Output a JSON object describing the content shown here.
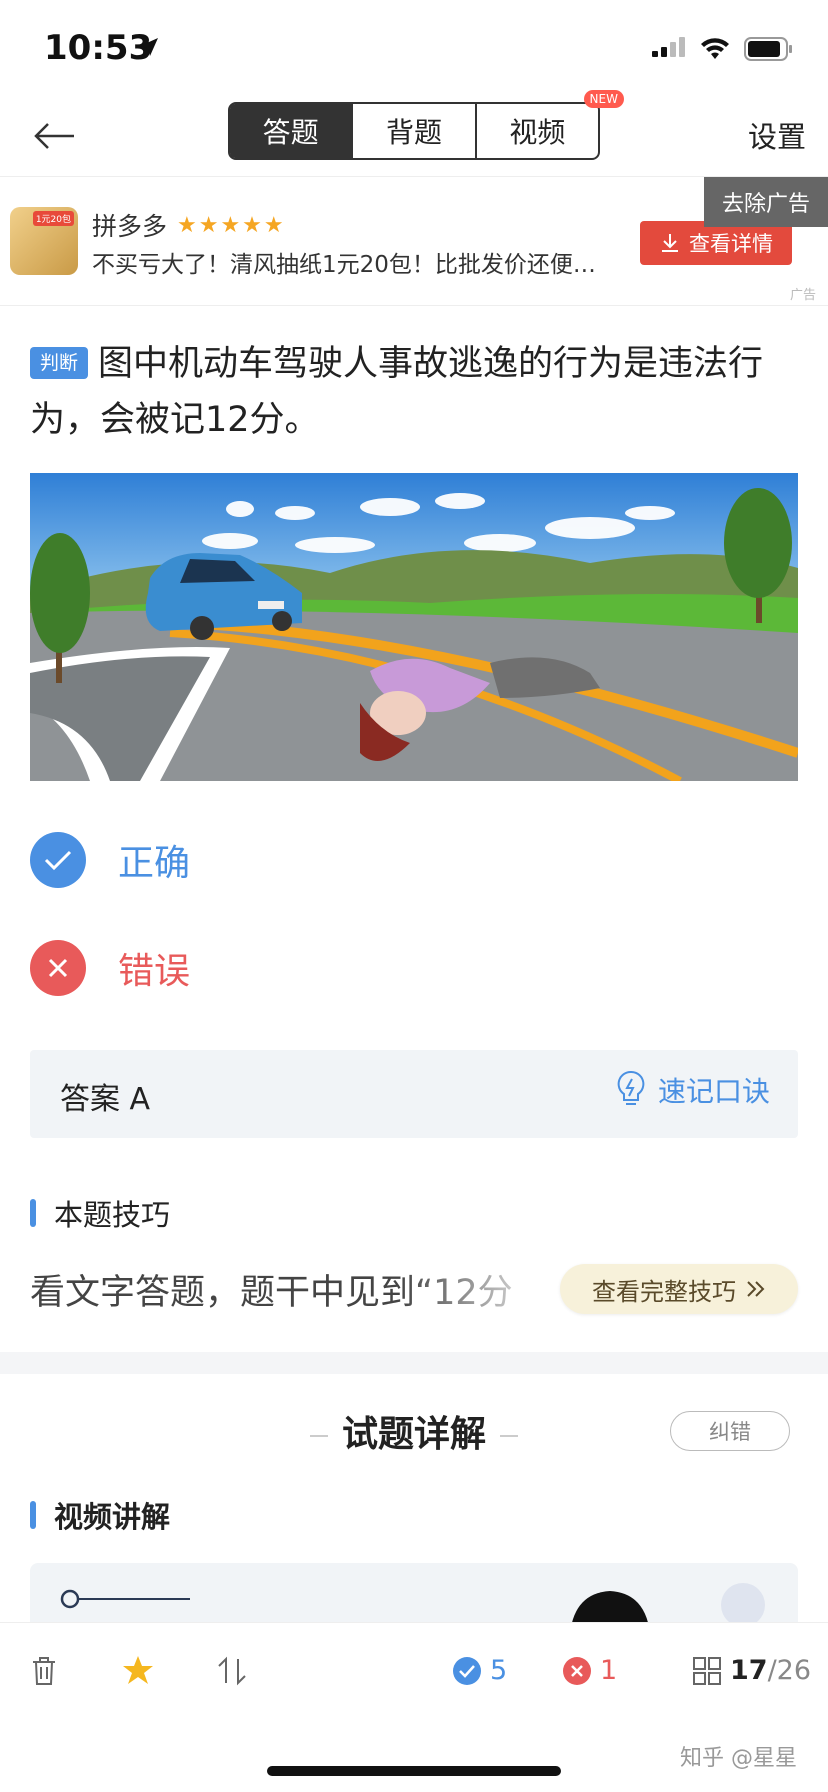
{
  "status_bar": {
    "time": "10:53"
  },
  "nav": {
    "tabs": [
      {
        "label": "答题",
        "active": true
      },
      {
        "label": "背题",
        "active": false
      },
      {
        "label": "视频",
        "active": false,
        "badge": "NEW"
      }
    ],
    "settings_label": "设置"
  },
  "ad": {
    "name": "拼多多",
    "rating_stars": "★★★★★",
    "description": "不买亏大了！清风抽纸1元20包！比批发价还便…",
    "button_label": "查看详情",
    "remove_label": "去除广告",
    "ad_label": "广告",
    "thumb_tag": "1元20包"
  },
  "question": {
    "type_tag": "判断",
    "text": "图中机动车驾驶人事故逃逸的行为是违法行为，会被记12分。"
  },
  "options": [
    {
      "label": "正确",
      "color": "#4a90e2"
    },
    {
      "label": "错误",
      "color": "#e85a5a"
    }
  ],
  "answer": {
    "text": "答案 A",
    "mnemonic_label": "速记口诀"
  },
  "tip": {
    "section_title": "本题技巧",
    "text": "看文字答题，题干中见到“12分",
    "button_label": "查看完整技巧"
  },
  "detail": {
    "title": "试题详解",
    "correct_label": "纠错",
    "video_section_title": "视频讲解"
  },
  "bottom_bar": {
    "correct_count": "5",
    "wrong_count": "1",
    "current": "17",
    "total": "/26"
  },
  "watermark": "知乎 @星星",
  "colors": {
    "accent": "#4a90e2",
    "error": "#e85a5a",
    "ad_red": "#e34a3d"
  }
}
